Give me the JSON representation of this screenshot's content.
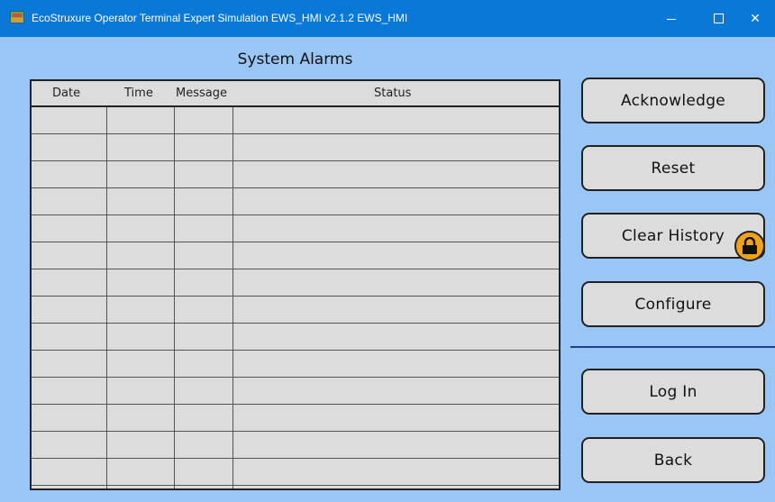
{
  "window": {
    "title": "EcoStruxure Operator Terminal Expert Simulation EWS_HMI v2.1.2 EWS_HMI",
    "minimize_icon": "minimize-icon",
    "maximize_icon": "maximize-icon",
    "close_icon": "close-icon",
    "close_glyph": "✕"
  },
  "alarms": {
    "title": "System Alarms",
    "columns": [
      "Date",
      "Time",
      "Message",
      "Status"
    ],
    "rows": [
      {
        "date": "",
        "time": "",
        "message": "",
        "status": ""
      },
      {
        "date": "",
        "time": "",
        "message": "",
        "status": ""
      },
      {
        "date": "",
        "time": "",
        "message": "",
        "status": ""
      },
      {
        "date": "",
        "time": "",
        "message": "",
        "status": ""
      },
      {
        "date": "",
        "time": "",
        "message": "",
        "status": ""
      },
      {
        "date": "",
        "time": "",
        "message": "",
        "status": ""
      },
      {
        "date": "",
        "time": "",
        "message": "",
        "status": ""
      },
      {
        "date": "",
        "time": "",
        "message": "",
        "status": ""
      },
      {
        "date": "",
        "time": "",
        "message": "",
        "status": ""
      },
      {
        "date": "",
        "time": "",
        "message": "",
        "status": ""
      },
      {
        "date": "",
        "time": "",
        "message": "",
        "status": ""
      },
      {
        "date": "",
        "time": "",
        "message": "",
        "status": ""
      },
      {
        "date": "",
        "time": "",
        "message": "",
        "status": ""
      },
      {
        "date": "",
        "time": "",
        "message": "",
        "status": ""
      }
    ]
  },
  "buttons": {
    "acknowledge": "Acknowledge",
    "reset": "Reset",
    "clear_history": "Clear History",
    "configure": "Configure",
    "log_in": "Log In",
    "back": "Back"
  },
  "icons": {
    "app": "app-icon",
    "lock": "lock-icon"
  },
  "colors": {
    "titlebar": "#0a78d7",
    "background": "#99c6f5",
    "button": "#dcdcdc",
    "lock_badge": "#f0a21a",
    "divider": "#1f3f8a"
  }
}
